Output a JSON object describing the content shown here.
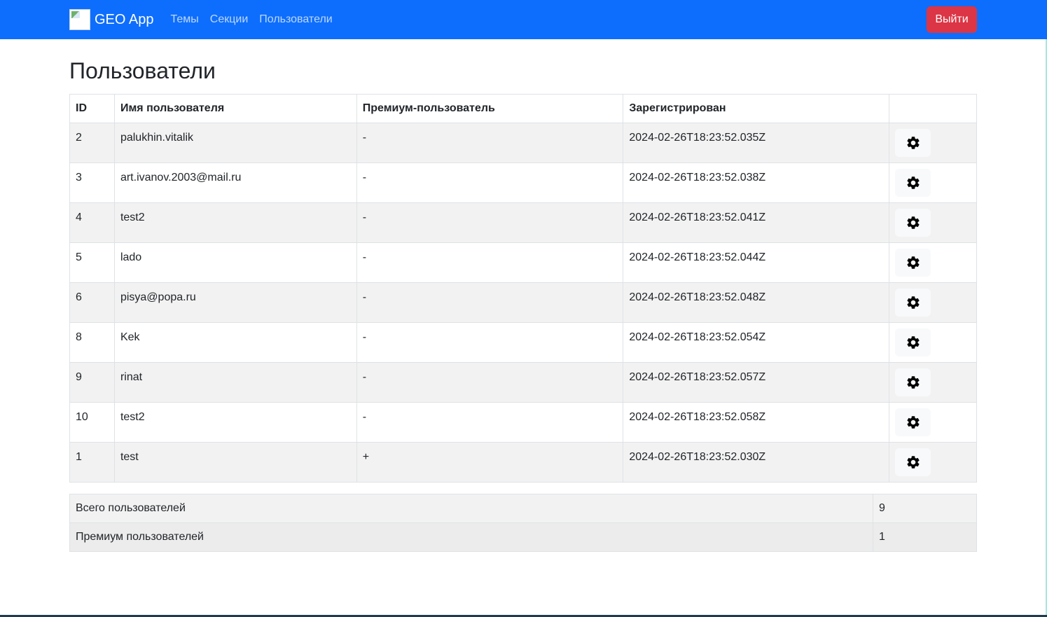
{
  "navbar": {
    "brand": "GEO App",
    "links": [
      "Темы",
      "Секции",
      "Пользователи"
    ],
    "logout_label": "Выйти",
    "color": "#0d6efd",
    "logout_color": "#dc3545"
  },
  "page": {
    "title": "Пользователи"
  },
  "users_table": {
    "headers": [
      "ID",
      "Имя пользователя",
      "Премиум-пользователь",
      "Зарегистрирован",
      ""
    ],
    "rows": [
      {
        "id": "2",
        "name": "palukhin.vitalik",
        "premium": "-",
        "registered": "2024-02-26T18:23:52.035Z"
      },
      {
        "id": "3",
        "name": "art.ivanov.2003@mail.ru",
        "premium": "-",
        "registered": "2024-02-26T18:23:52.038Z"
      },
      {
        "id": "4",
        "name": "test2",
        "premium": "-",
        "registered": "2024-02-26T18:23:52.041Z"
      },
      {
        "id": "5",
        "name": "lado",
        "premium": "-",
        "registered": "2024-02-26T18:23:52.044Z"
      },
      {
        "id": "6",
        "name": "pisya@popa.ru",
        "premium": "-",
        "registered": "2024-02-26T18:23:52.048Z"
      },
      {
        "id": "8",
        "name": "Kek",
        "premium": "-",
        "registered": "2024-02-26T18:23:52.054Z"
      },
      {
        "id": "9",
        "name": "rinat",
        "premium": "-",
        "registered": "2024-02-26T18:23:52.057Z"
      },
      {
        "id": "10",
        "name": "test2",
        "premium": "-",
        "registered": "2024-02-26T18:23:52.058Z"
      },
      {
        "id": "1",
        "name": "test",
        "premium": "+",
        "registered": "2024-02-26T18:23:52.030Z"
      }
    ],
    "action_icon": "gear-icon"
  },
  "stats": {
    "total_label": "Всего пользователей",
    "total_value": "9",
    "premium_label": "Премиум пользователей",
    "premium_value": "1"
  }
}
